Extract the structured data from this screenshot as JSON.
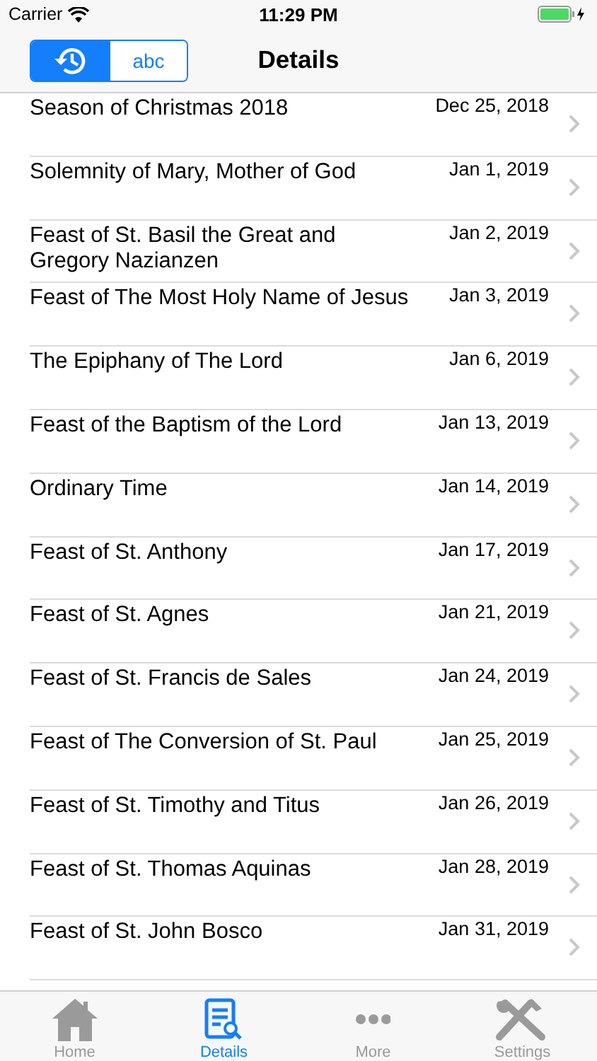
{
  "status_bar": {
    "carrier": "Carrier",
    "time": "11:29 PM"
  },
  "nav": {
    "segments": [
      {
        "kind": "icon",
        "selected": true
      },
      {
        "kind": "text",
        "label": "abc",
        "selected": false
      }
    ],
    "title": "Details"
  },
  "rows": [
    {
      "title": "Season of Christmas 2018",
      "date": "Dec 25, 2018"
    },
    {
      "title": "Solemnity of Mary, Mother of God",
      "date": "Jan 1, 2019"
    },
    {
      "title": "Feast of St. Basil the Great and Gregory Nazianzen",
      "date": "Jan 2, 2019"
    },
    {
      "title": "Feast of The Most Holy Name of Jesus",
      "date": "Jan 3, 2019"
    },
    {
      "title": "The Epiphany of The Lord",
      "date": "Jan 6, 2019"
    },
    {
      "title": "Feast of the Baptism of the Lord",
      "date": "Jan 13, 2019"
    },
    {
      "title": "Ordinary Time",
      "date": "Jan 14, 2019"
    },
    {
      "title": "Feast of St. Anthony",
      "date": "Jan 17, 2019"
    },
    {
      "title": "Feast of St. Agnes",
      "date": "Jan 21, 2019"
    },
    {
      "title": "Feast of St. Francis de Sales",
      "date": "Jan 24, 2019"
    },
    {
      "title": "Feast of The Conversion of St. Paul",
      "date": "Jan 25, 2019"
    },
    {
      "title": "Feast of St. Timothy and Titus",
      "date": "Jan 26, 2019"
    },
    {
      "title": "Feast of St. Thomas Aquinas",
      "date": "Jan 28, 2019"
    },
    {
      "title": "Feast of St. John Bosco",
      "date": "Jan 31, 2019"
    }
  ],
  "tab_bar": [
    {
      "kind": "home",
      "label": "Home",
      "selected": false
    },
    {
      "kind": "details",
      "label": "Details",
      "selected": true
    },
    {
      "kind": "more",
      "label": "More",
      "selected": false
    },
    {
      "kind": "settings",
      "label": "Settings",
      "selected": false
    }
  ]
}
